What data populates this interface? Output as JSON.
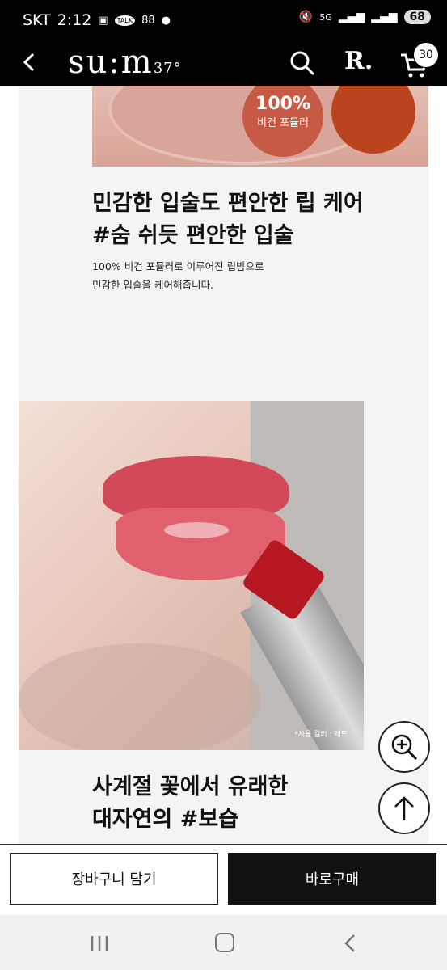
{
  "status_bar": {
    "carrier": "SKT",
    "time": "2:12",
    "notif_talk": "TALK",
    "notif_grid": "88",
    "network": "5G",
    "battery": "68"
  },
  "app_bar": {
    "logo_text": "su:m",
    "logo_suffix": "37°",
    "r_logo": "R.",
    "cart_count": "30"
  },
  "section1": {
    "badge_big": "100%",
    "badge_small": "비건 포뮬러",
    "heading_line1": "민감한 입술도 편안한 립 케어",
    "heading_line2": "#숨 쉬듯 편안한 입술",
    "body_line1": "100% 비건 포뮬러로 이루어진 립밤으로",
    "body_line2": "민감한 입술을 케어해줍니다."
  },
  "section2": {
    "photo_caption": "*사용 컬러 : 레드",
    "heading_line1": "사계절 꽃에서 유래한",
    "heading_line2": "대자연의 #보습"
  },
  "bottom": {
    "cart_button": "장바구니 담기",
    "buy_button": "바로구매"
  },
  "colors": {
    "badge": "#c65a45",
    "lipstick": "#b51820"
  }
}
